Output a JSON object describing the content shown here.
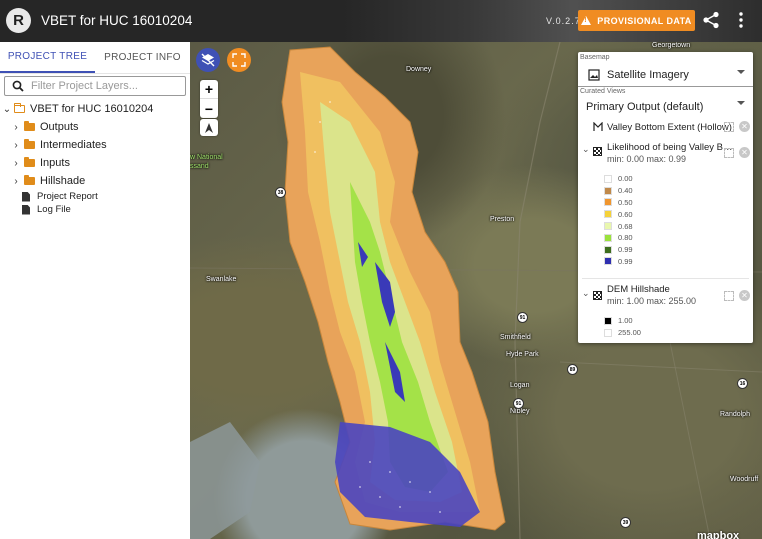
{
  "app": {
    "title": "VBET for HUC 16010204",
    "version": "V.0.2.7",
    "provisional_label": "PROVISIONAL DATA",
    "logo_letter": "R"
  },
  "sidebar": {
    "tabs": [
      {
        "label": "PROJECT TREE",
        "active": true
      },
      {
        "label": "PROJECT INFO",
        "active": false
      }
    ],
    "filter_placeholder": "Filter Project Layers...",
    "tree": {
      "root": "VBET for HUC 16010204",
      "folders": [
        "Outputs",
        "Intermediates",
        "Inputs",
        "Hillshade"
      ],
      "files": [
        "Project Report",
        "Log File"
      ]
    }
  },
  "map": {
    "zoom_in": "+",
    "zoom_out": "−",
    "places": [
      "Downey",
      "Georgetown",
      "Preston",
      "Swanlake",
      "Smithfield",
      "Hyde Park",
      "Logan",
      "Nibley",
      "Randolph",
      "Woodruff",
      "w National",
      "ssand"
    ],
    "route_shields": [
      "38",
      "91",
      "91",
      "89",
      "16",
      "39"
    ],
    "attribution": "mapbox"
  },
  "panel": {
    "basemap_label": "Basemap",
    "basemap_value": "Satellite Imagery",
    "curated_label": "Curated Views",
    "curated_value": "Primary Output (default)",
    "layers": [
      {
        "name": "Valley Bottom Extent (Hollow)",
        "sub": ""
      },
      {
        "name": "Likelihood of being Valley Bottom",
        "sub": "min: 0.00 max: 0.99",
        "legend": [
          {
            "label": "0.00",
            "color": "#ffffff"
          },
          {
            "label": "0.40",
            "color": "#c0894a"
          },
          {
            "label": "0.50",
            "color": "#f0962e"
          },
          {
            "label": "0.60",
            "color": "#f5d23a"
          },
          {
            "label": "0.68",
            "color": "#e9f7ae"
          },
          {
            "label": "0.80",
            "color": "#9ae23c"
          },
          {
            "label": "0.99",
            "color": "#3e6e1e"
          },
          {
            "label": "0.99",
            "color": "#2f2fb0"
          }
        ]
      },
      {
        "name": "DEM Hillshade",
        "sub": "min: 1.00 max: 255.00",
        "legend": [
          {
            "label": "1.00",
            "color": "#000000"
          },
          {
            "label": "255.00",
            "color": "#ffffff"
          }
        ]
      }
    ]
  },
  "colors": {
    "accent": "#3f51b5",
    "provisional": "#f08c22",
    "folder": "#e08c1a",
    "layers_button": "#3f51b5",
    "fullscreen_button": "#f08c22"
  }
}
